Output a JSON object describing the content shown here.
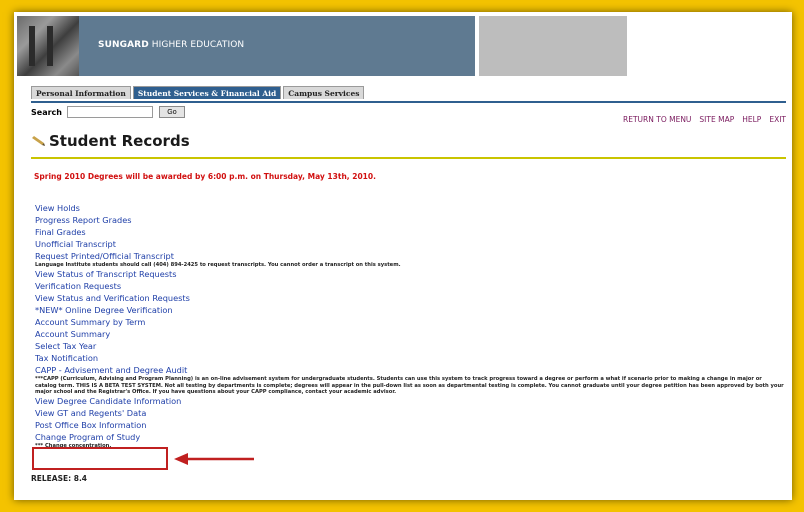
{
  "banner": {
    "brand_bold": "SUNGARD",
    "brand_rest": " HIGHER EDUCATION"
  },
  "tabs": [
    {
      "label": "Personal Information",
      "active": false
    },
    {
      "label": "Student Services & Financial Aid",
      "active": true
    },
    {
      "label": "Campus Services",
      "active": false
    }
  ],
  "search": {
    "label": "Search",
    "value": "",
    "button_label": "Go"
  },
  "toplinks": [
    "RETURN TO MENU",
    "SITE MAP",
    "HELP",
    "EXIT"
  ],
  "page_title": "Student Records",
  "notice": "Spring 2010 Degrees will be awarded by 6:00 p.m. on Thursday, May 13th, 2010.",
  "menu": [
    {
      "label": "View Holds"
    },
    {
      "label": "Progress Report Grades"
    },
    {
      "label": "Final Grades"
    },
    {
      "label": "Unofficial Transcript"
    },
    {
      "label": "Request Printed/Official Transcript",
      "desc": "Language Institute students should call (404) 894-2425 to request transcripts. You cannot order a transcript on this system."
    },
    {
      "label": "View Status of Transcript Requests"
    },
    {
      "label": "Verification Requests"
    },
    {
      "label": "View Status and Verification Requests"
    },
    {
      "label": "*NEW* Online Degree Verification"
    },
    {
      "label": "Account Summary by Term"
    },
    {
      "label": "Account Summary"
    },
    {
      "label": "Select Tax Year"
    },
    {
      "label": "Tax Notification"
    },
    {
      "label": "CAPP - Advisement and Degree Audit",
      "desc": "***CAPP (Curriculum, Advising and Program Planning) is an on-line advisement system for undergraduate students. Students can use this system to track progress toward a degree or perform a what if scenario prior to making a change in major or catalog term. THIS IS A BETA TEST SYSTEM. Not all testing by departments is complete; degrees will appear in the pull-down list as soon as departmental testing is complete. You cannot graduate until your degree petition has been approved by both your major school and the Registrar's Office. If you have questions about your CAPP compliance, contact your academic advisor."
    },
    {
      "label": "View Degree Candidate Information"
    },
    {
      "label": "View GT and Regents' Data"
    },
    {
      "label": "Post Office Box Information"
    },
    {
      "label": "Change Program of Study",
      "desc": "*** Change concentration."
    }
  ],
  "release": "RELEASE: 8.4",
  "colors": {
    "outer_background": "#f4c300",
    "tab_active": "#2f5f8f",
    "link": "#1f3fa8",
    "notice": "#d11010",
    "annotation": "#c02020"
  }
}
